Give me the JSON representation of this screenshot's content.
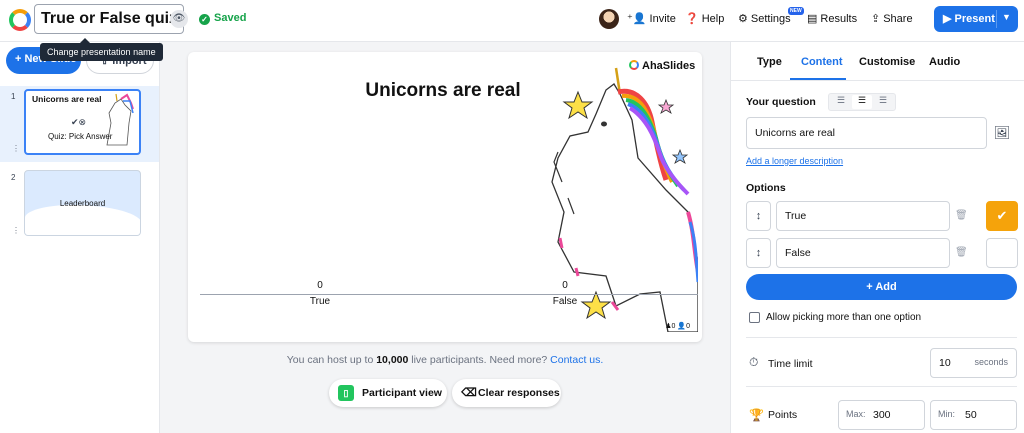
{
  "header": {
    "title": "True or False quiz",
    "saved_label": "Saved",
    "tooltip": "Change presentation name",
    "invite_label": "Invite",
    "help_label": "Help",
    "settings_label": "Settings",
    "settings_badge": "NEW",
    "results_label": "Results",
    "share_label": "Share",
    "present_label": "Present"
  },
  "sidebar": {
    "new_slide_label": "New Slide",
    "import_label": "Import",
    "slides": [
      {
        "number": "1",
        "title": "Unicorns are real",
        "subtitle": "Quiz: Pick Answer"
      },
      {
        "number": "2",
        "title": "Leaderboard"
      }
    ]
  },
  "slide": {
    "title": "Unicorns are real",
    "brand": "AhaSlides",
    "reactions": "0",
    "participants": "0"
  },
  "chart_data": {
    "type": "bar",
    "categories": [
      "True",
      "False"
    ],
    "values": [
      0,
      0
    ],
    "title": "Unicorns are real"
  },
  "center": {
    "host_text_before": "You can host up to ",
    "host_bold": "10,000",
    "host_text_after": " live participants. Need more? ",
    "host_link": "Contact us.",
    "participant_view_label": "Participant view",
    "clear_responses_label": "Clear responses"
  },
  "panel": {
    "tabs": [
      "Type",
      "Content",
      "Customise",
      "Audio"
    ],
    "active_tab": "Content",
    "question_label": "Your question",
    "question_value": "Unicorns are real",
    "desc_link": "Add a longer description",
    "options_label": "Options",
    "options": [
      {
        "value": "True",
        "correct": true
      },
      {
        "value": "False",
        "correct": false
      }
    ],
    "add_label": "Add",
    "multi_label": "Allow picking more than one option",
    "time_label": "Time limit",
    "time_value": "10",
    "time_unit": "seconds",
    "points_label": "Points",
    "points_max_prefix": "Max:",
    "points_max": "300",
    "points_min_prefix": "Min:",
    "points_min": "50"
  },
  "colors": {
    "accent": "#1d72e8",
    "correct": "#f5a30b",
    "saved": "#16a34a"
  }
}
